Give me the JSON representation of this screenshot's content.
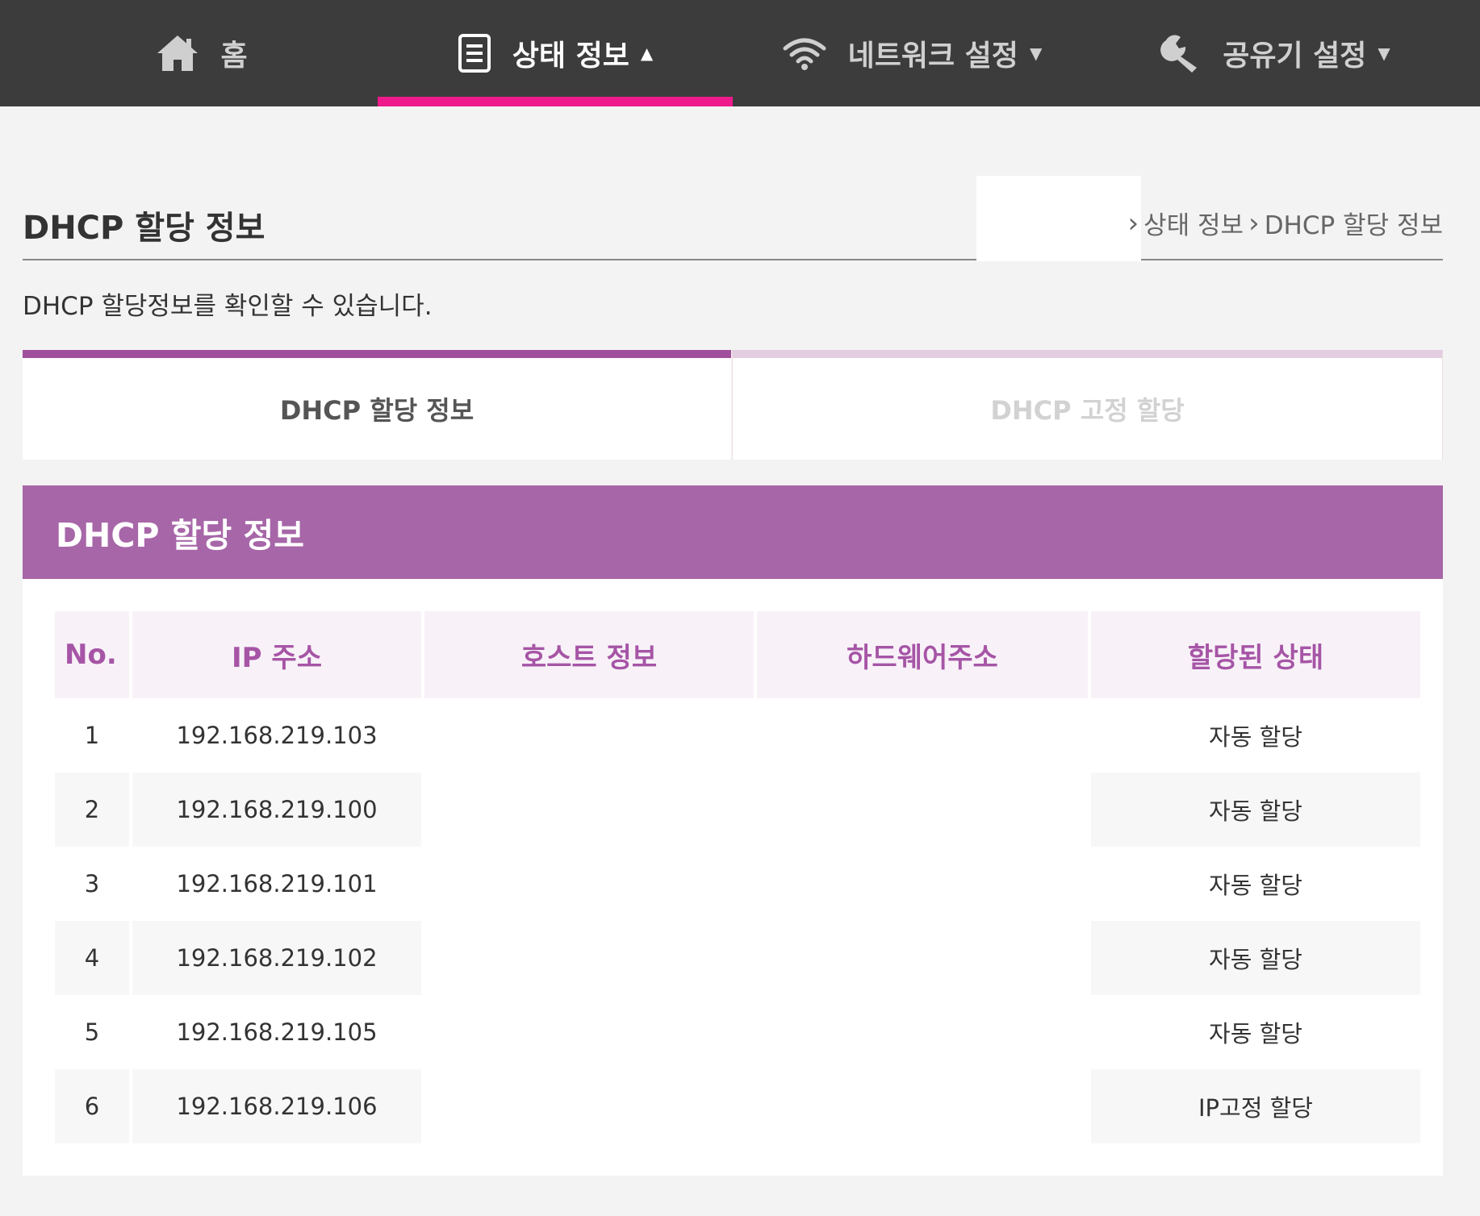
{
  "nav": {
    "items": [
      {
        "label": "홈",
        "icon": "home-icon"
      },
      {
        "label": "상태 정보",
        "icon": "document-icon",
        "caret": "▲"
      },
      {
        "label": "네트워크 설정",
        "icon": "wifi-icon",
        "caret": "▼"
      },
      {
        "label": "공유기 설정",
        "icon": "wrench-icon",
        "caret": "▼"
      }
    ],
    "active_color": "#ee1a8c"
  },
  "page": {
    "title": "DHCP 할당 정보",
    "breadcrumb": [
      "상태 정보",
      "DHCP 할당 정보"
    ],
    "description": "DHCP 할당정보를 확인할 수 있습니다."
  },
  "tabs": [
    {
      "label": "DHCP 할당 정보"
    },
    {
      "label": "DHCP 고정 할당"
    }
  ],
  "panel": {
    "title": "DHCP 할당 정보",
    "header_color": "#a766a8"
  },
  "table": {
    "columns": [
      "No.",
      "IP 주소",
      "호스트 정보",
      "하드웨어주소",
      "할당된 상태"
    ],
    "rows": [
      {
        "no": "1",
        "ip": "192.168.219.103",
        "host": "",
        "hw": "",
        "status": "자동 할당"
      },
      {
        "no": "2",
        "ip": "192.168.219.100",
        "host": "",
        "hw": "",
        "status": "자동 할당"
      },
      {
        "no": "3",
        "ip": "192.168.219.101",
        "host": "",
        "hw": "",
        "status": "자동 할당"
      },
      {
        "no": "4",
        "ip": "192.168.219.102",
        "host": "",
        "hw": "",
        "status": "자동 할당"
      },
      {
        "no": "5",
        "ip": "192.168.219.105",
        "host": "",
        "hw": "",
        "status": "자동 할당"
      },
      {
        "no": "6",
        "ip": "192.168.219.106",
        "host": "",
        "hw": "",
        "status": "IP고정 할당"
      }
    ]
  }
}
